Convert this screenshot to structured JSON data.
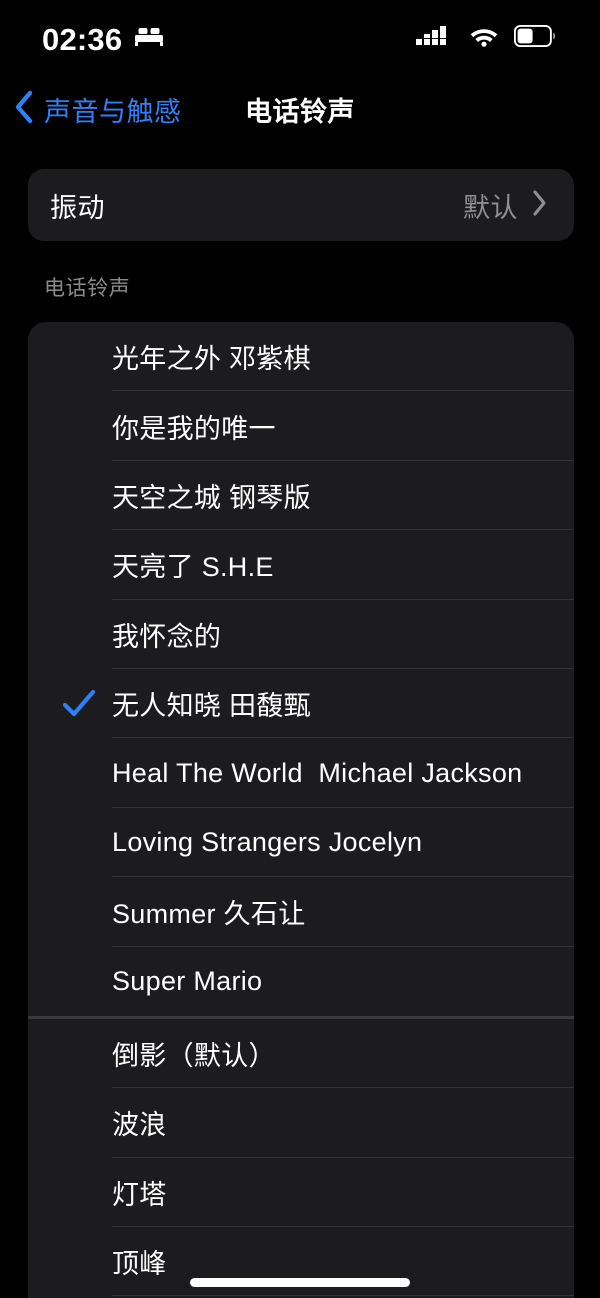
{
  "status_bar": {
    "time": "02:36",
    "focus_icon": "bed-icon",
    "cellular_icon": "cellular-signal-icon",
    "wifi_icon": "wifi-icon",
    "battery_icon": "battery-icon",
    "battery_level_percent": 45
  },
  "nav": {
    "back_label": "声音与触感",
    "back_icon": "chevron-left-icon",
    "title": "电话铃声"
  },
  "vibration": {
    "label": "振动",
    "value": "默认",
    "chevron_icon": "chevron-right-icon"
  },
  "section": {
    "header": "电话铃声"
  },
  "ringtones": {
    "custom": [
      {
        "label": "光年之外 邓紫棋",
        "selected": false
      },
      {
        "label": "你是我的唯一",
        "selected": false
      },
      {
        "label": "天空之城 钢琴版",
        "selected": false
      },
      {
        "label": "天亮了 S.H.E",
        "selected": false
      },
      {
        "label": "我怀念的",
        "selected": false
      },
      {
        "label": "无人知晓 田馥甄",
        "selected": true
      },
      {
        "label": "Heal The World  Michael Jackson",
        "selected": false
      },
      {
        "label": "Loving Strangers Jocelyn",
        "selected": false
      },
      {
        "label": "Summer 久石让",
        "selected": false
      },
      {
        "label": "Super Mario",
        "selected": false
      }
    ],
    "system": [
      {
        "label": "倒影（默认）",
        "selected": false
      },
      {
        "label": "波浪",
        "selected": false
      },
      {
        "label": "灯塔",
        "selected": false
      },
      {
        "label": "顶峰",
        "selected": false
      }
    ]
  },
  "colors": {
    "accent_blue": "#2f7ff7",
    "background": "#000000",
    "card": "#1c1c1e",
    "separator": "#333336",
    "secondary_text": "#8e8e93"
  },
  "home_indicator": "home-indicator"
}
